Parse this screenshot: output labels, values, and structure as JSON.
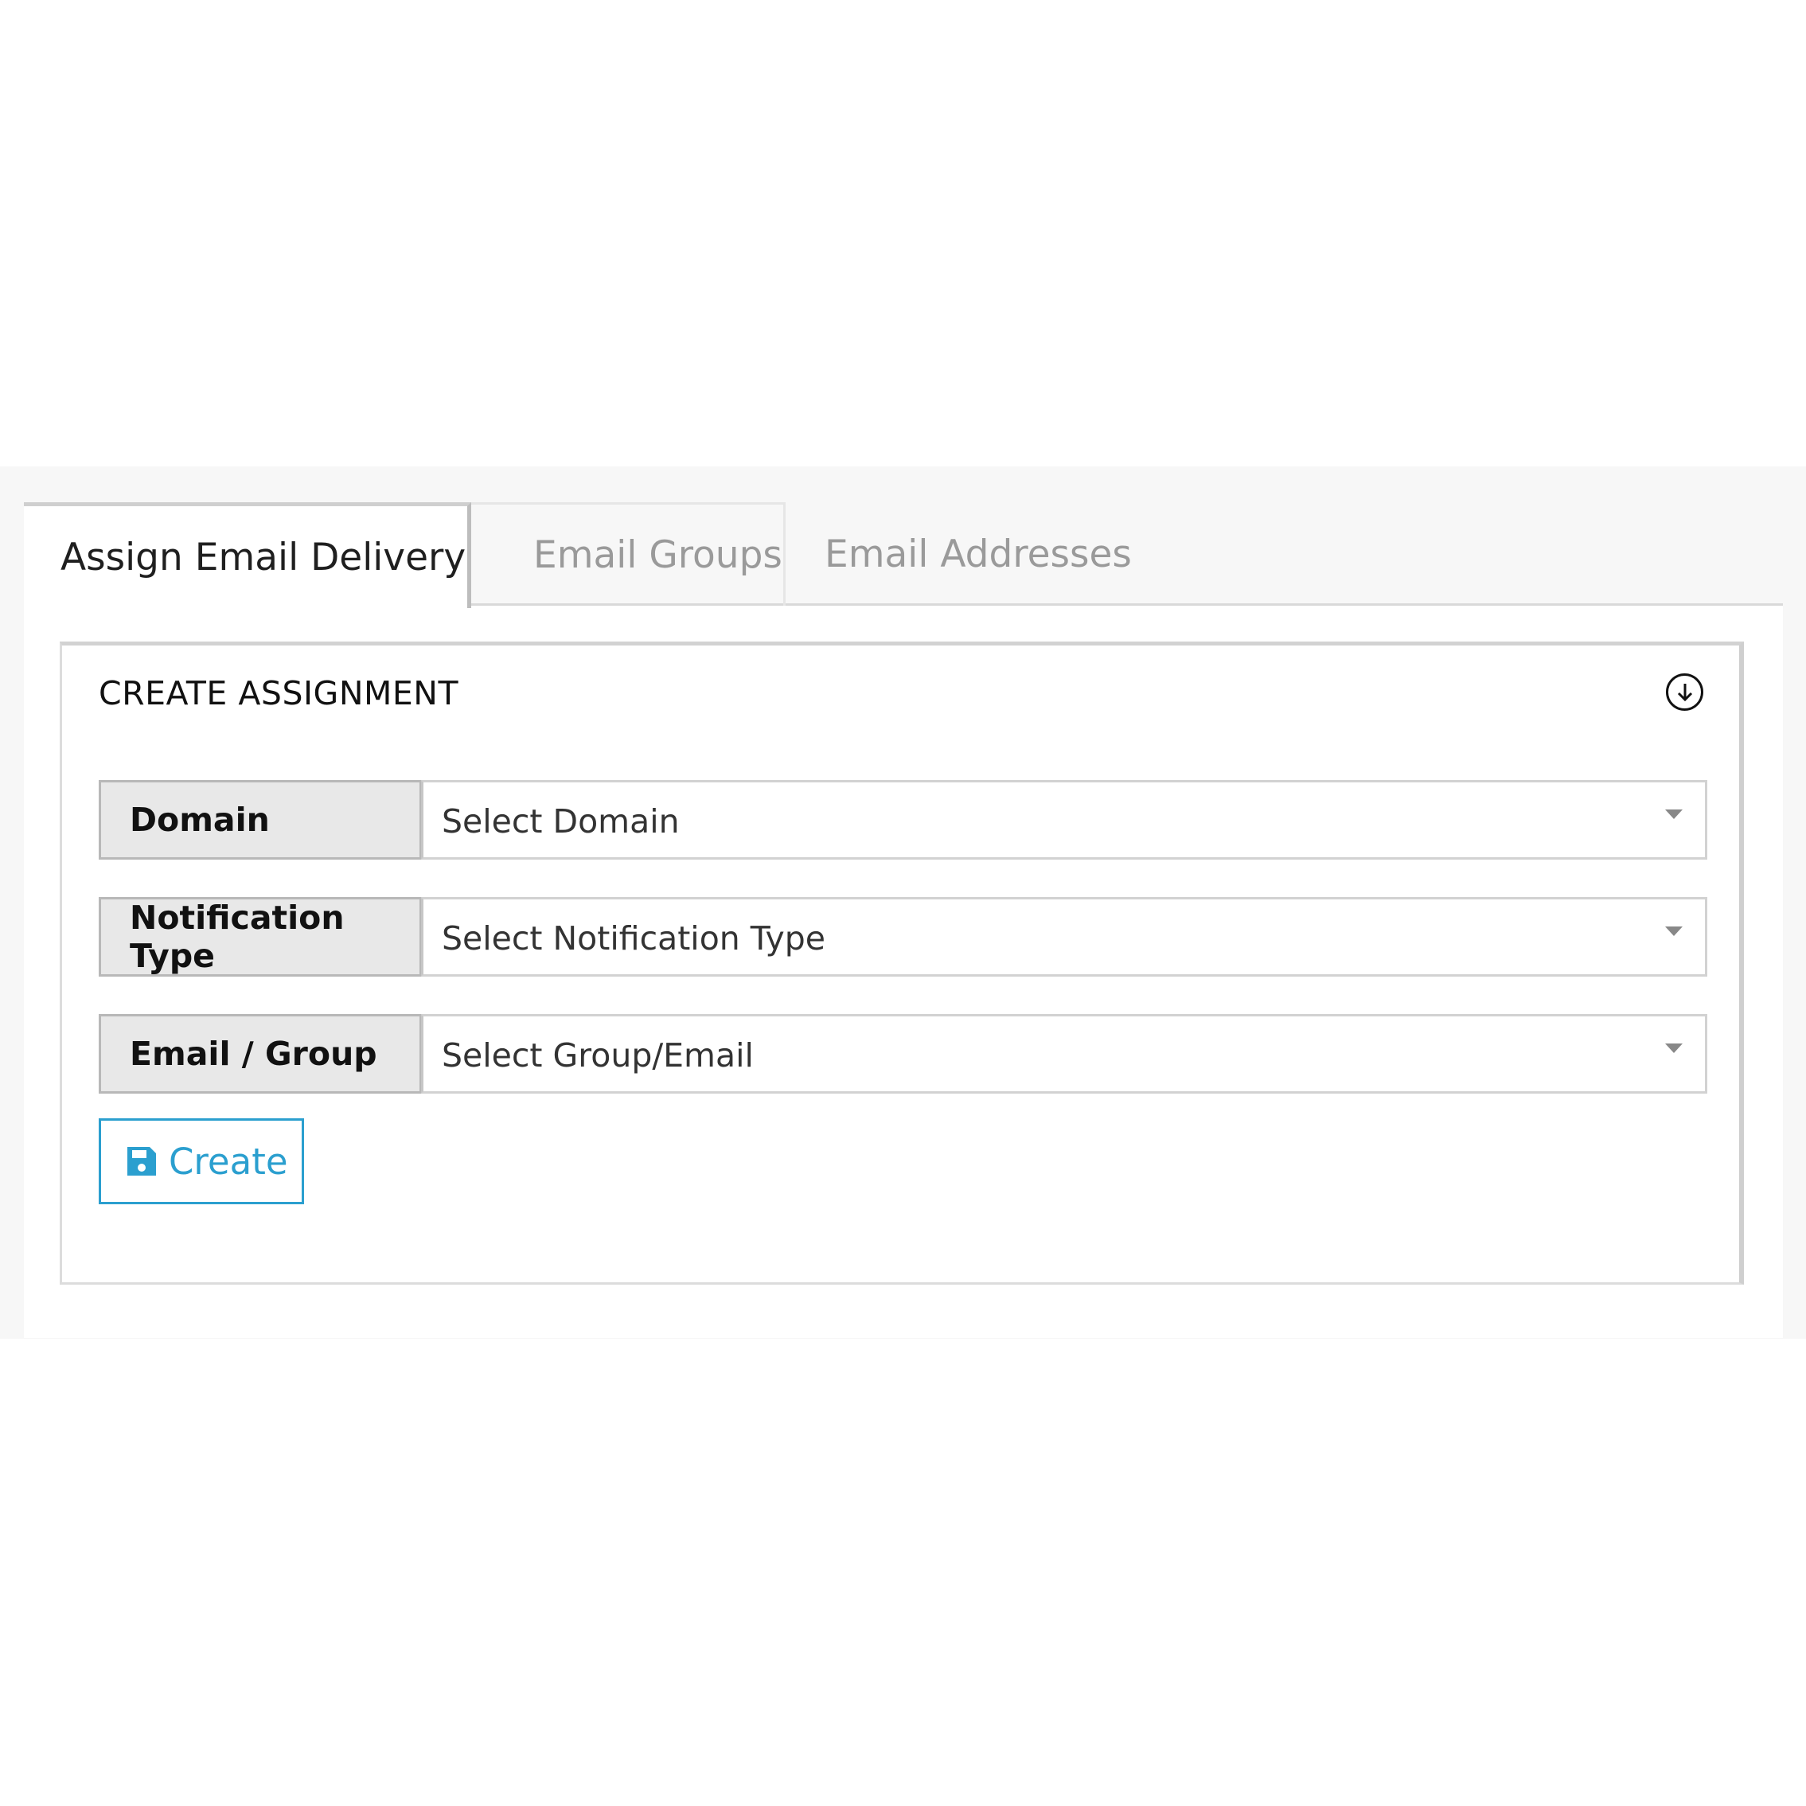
{
  "tabs": [
    {
      "label": "Assign Email Delivery",
      "active": true
    },
    {
      "label": "Email Groups",
      "active": false
    },
    {
      "label": "Email Addresses",
      "active": false
    }
  ],
  "card": {
    "title": "CREATE ASSIGNMENT",
    "toggle_icon": "arrow-down-circle-icon"
  },
  "form": {
    "domain": {
      "label": "Domain",
      "placeholder": "Select Domain"
    },
    "notification_type": {
      "label": "Notification Type",
      "placeholder": "Select Notification Type"
    },
    "email_group": {
      "label": "Email / Group",
      "placeholder": "Select Group/Email"
    }
  },
  "create_button": {
    "label": "Create",
    "icon": "save-icon"
  },
  "colors": {
    "accent": "#2b9fcf",
    "label_bg": "#e8e8e8",
    "band_bg": "#f7f7f7",
    "inactive_tab_text": "#9a9a9a"
  }
}
